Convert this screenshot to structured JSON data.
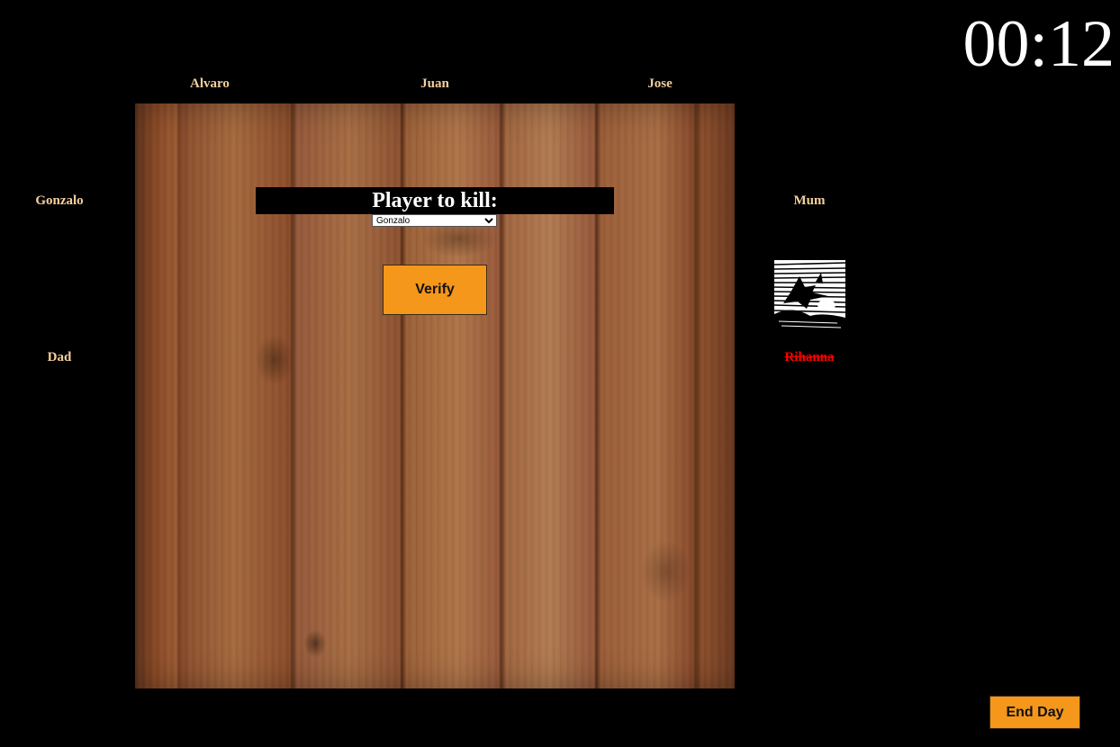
{
  "timer": "00:12",
  "players": {
    "alvaro": {
      "name": "Alvaro",
      "dead": false
    },
    "juan": {
      "name": "Juan",
      "dead": false
    },
    "jose": {
      "name": "Jose",
      "dead": false
    },
    "gonzalo": {
      "name": "Gonzalo",
      "dead": false
    },
    "mum": {
      "name": "Mum",
      "dead": false
    },
    "dad": {
      "name": "Dad",
      "dead": false
    },
    "rihanna": {
      "name": "Rihanna",
      "dead": true
    }
  },
  "kill_panel": {
    "title": "Player to kill:",
    "selected": "Gonzalo",
    "options": [
      "Gonzalo"
    ],
    "verify_label": "Verify"
  },
  "end_day_label": "End Day",
  "avatar_icon": "witch-silhouette-icon",
  "colors": {
    "player_name": "#f3cf9c",
    "dead_player": "#ff0000",
    "button": "#f5971b"
  }
}
